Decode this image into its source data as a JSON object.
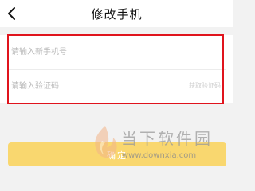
{
  "header": {
    "title": "修改手机",
    "back_icon": "chevron-left-icon"
  },
  "form": {
    "phone_placeholder": "请输入新手机号",
    "code_placeholder": "请输入验证码",
    "get_code_label": "获取验证码"
  },
  "confirm_label": "确定",
  "watermark": {
    "name": "当下软件园",
    "url": "www.downxia.com"
  },
  "colors": {
    "accent": "#f9d76f",
    "highlight_border": "#e0141d",
    "background": "#f2f2f2"
  }
}
